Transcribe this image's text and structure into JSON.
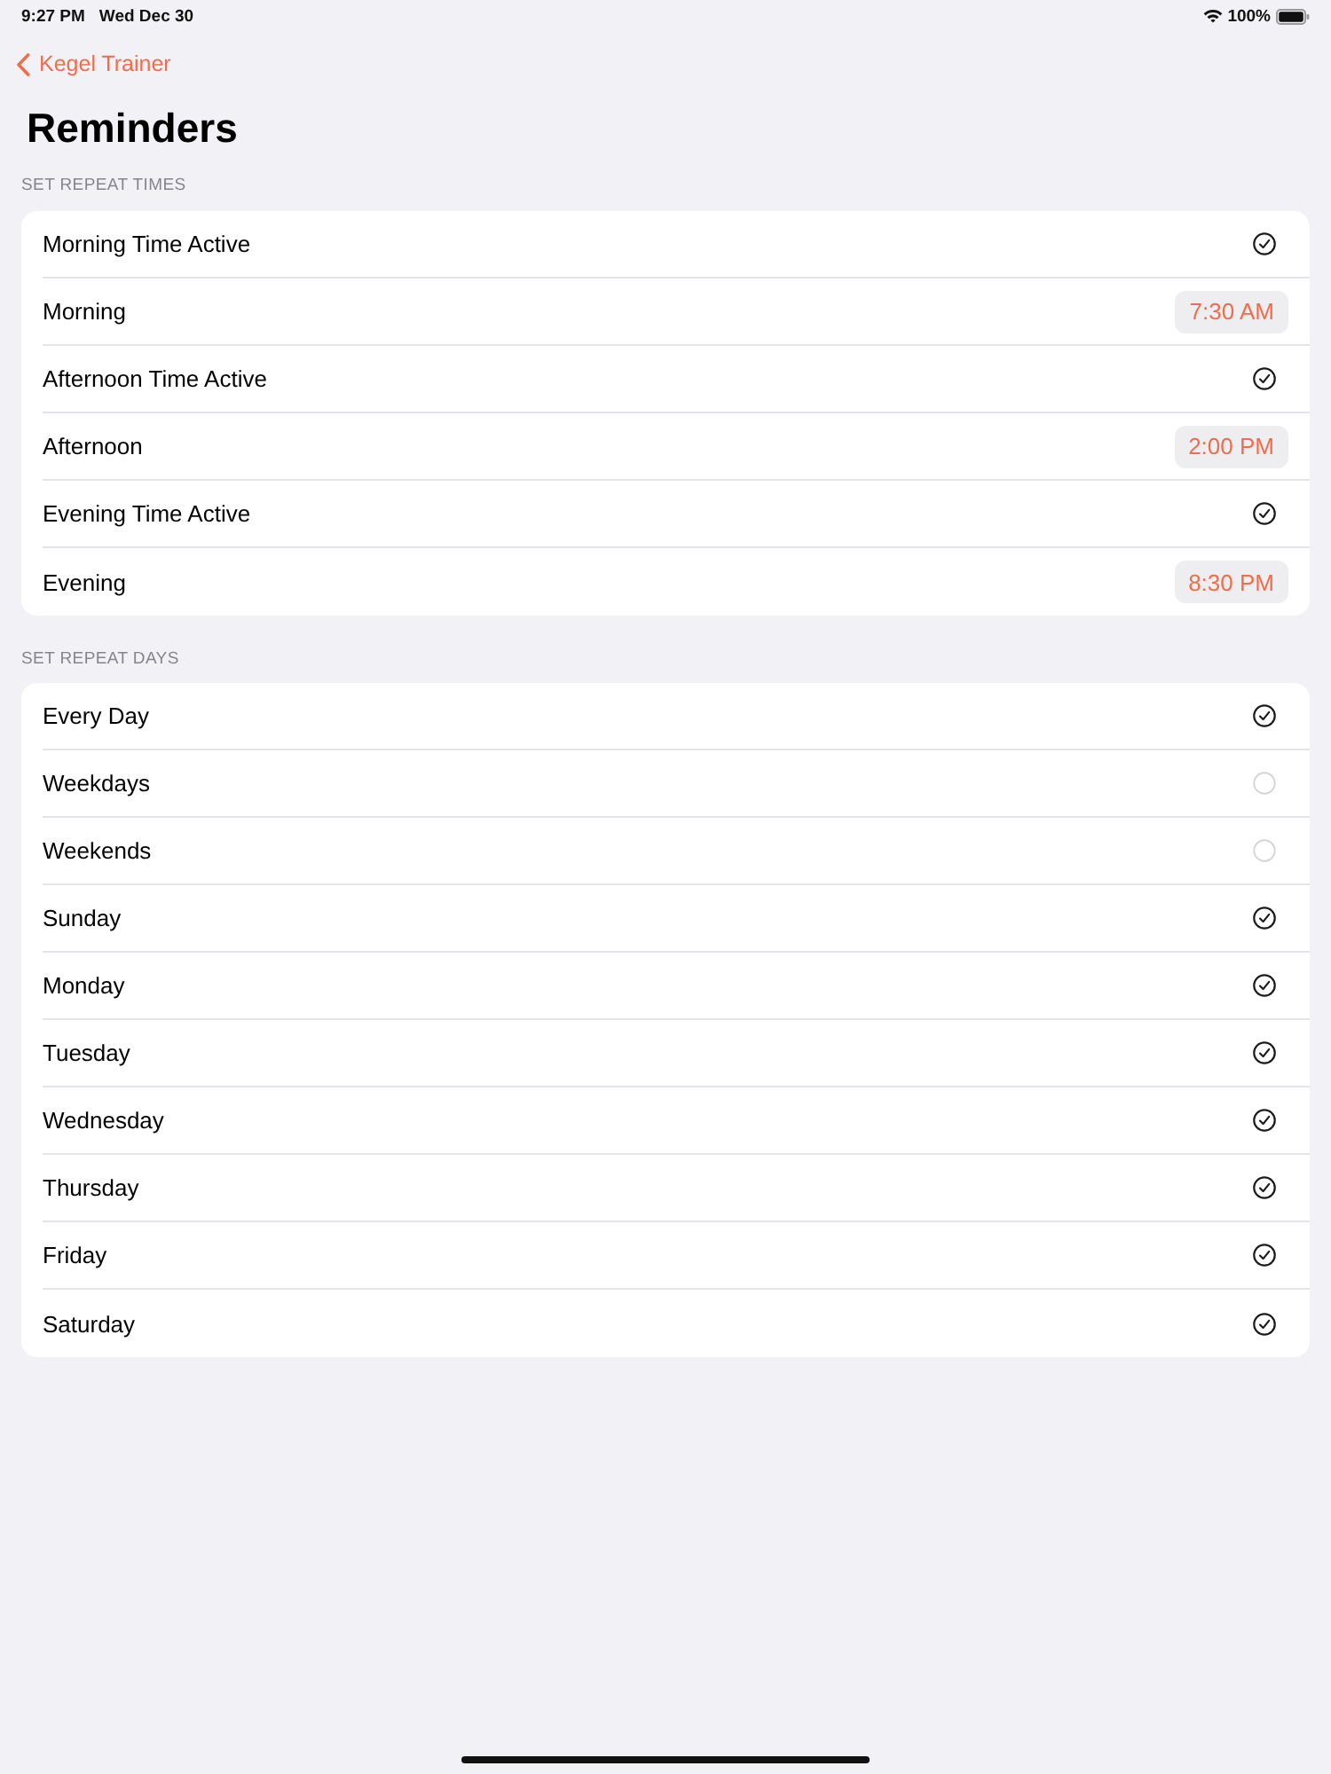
{
  "status_bar": {
    "time": "9:27 PM",
    "date": "Wed Dec 30",
    "battery": "100%"
  },
  "nav": {
    "back_label": "Kegel Trainer",
    "title": "Reminders"
  },
  "sections": [
    {
      "header": "SET REPEAT TIMES",
      "rows": [
        {
          "kind": "check",
          "label": "Morning Time Active",
          "checked": true
        },
        {
          "kind": "time",
          "label": "Morning",
          "value": "7:30 AM"
        },
        {
          "kind": "check",
          "label": "Afternoon Time Active",
          "checked": true
        },
        {
          "kind": "time",
          "label": "Afternoon",
          "value": "2:00 PM"
        },
        {
          "kind": "check",
          "label": "Evening Time Active",
          "checked": true
        },
        {
          "kind": "time",
          "label": "Evening",
          "value": "8:30 PM"
        }
      ]
    },
    {
      "header": "SET REPEAT DAYS",
      "rows": [
        {
          "kind": "check",
          "label": "Every Day",
          "checked": true
        },
        {
          "kind": "check",
          "label": "Weekdays",
          "checked": false
        },
        {
          "kind": "check",
          "label": "Weekends",
          "checked": false
        },
        {
          "kind": "check",
          "label": "Sunday",
          "checked": true
        },
        {
          "kind": "check",
          "label": "Monday",
          "checked": true
        },
        {
          "kind": "check",
          "label": "Tuesday",
          "checked": true
        },
        {
          "kind": "check",
          "label": "Wednesday",
          "checked": true
        },
        {
          "kind": "check",
          "label": "Thursday",
          "checked": true
        },
        {
          "kind": "check",
          "label": "Friday",
          "checked": true
        },
        {
          "kind": "check",
          "label": "Saturday",
          "checked": true
        }
      ]
    }
  ]
}
